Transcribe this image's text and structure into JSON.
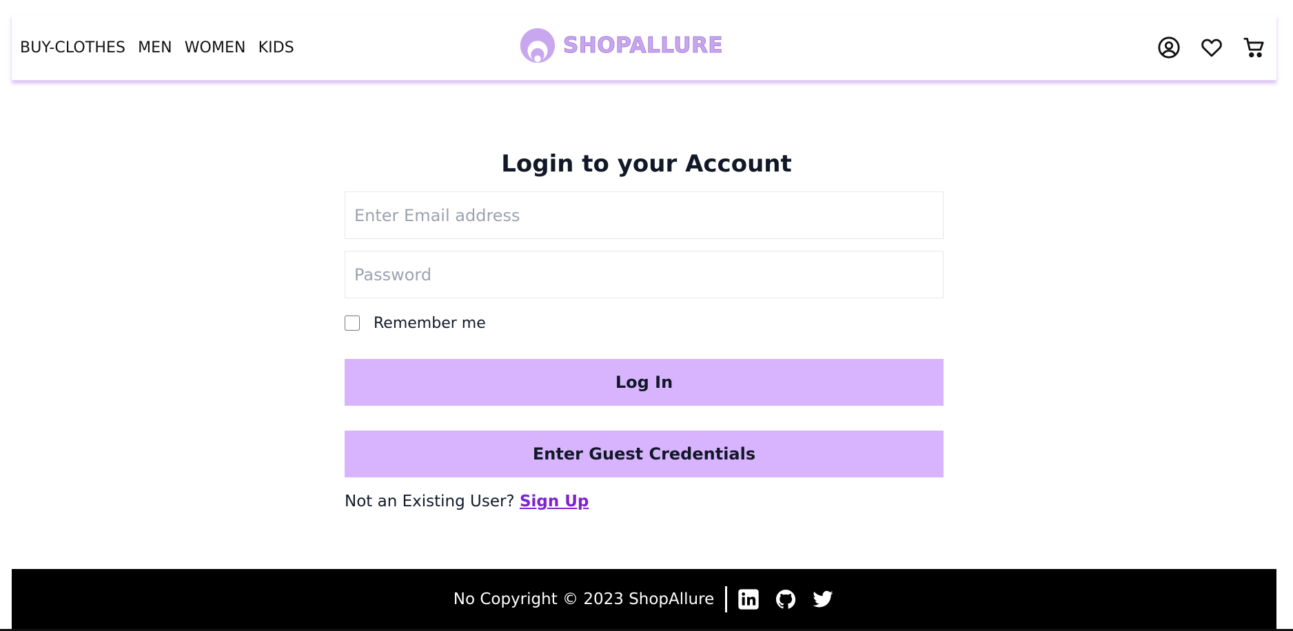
{
  "navbar": {
    "links": [
      "BUY-CLOTHES",
      "MEN",
      "WOMEN",
      "KIDS"
    ],
    "logo_text": "SHOPALLURE",
    "icons": [
      "user-circle-icon",
      "heart-icon",
      "cart-icon"
    ]
  },
  "login": {
    "title": "Login to your Account",
    "email_placeholder": "Enter Email address",
    "email_value": "",
    "password_placeholder": "Password",
    "password_value": "",
    "remember_label": "Remember me",
    "remember_checked": false,
    "login_button": "Log In",
    "guest_button": "Enter Guest Credentials",
    "signup_prompt": "Not an Existing User?",
    "signup_link": "Sign Up"
  },
  "footer": {
    "text": "No Copyright © 2023 ShopAllure",
    "icons": [
      "linkedin-icon",
      "github-icon",
      "twitter-icon"
    ]
  },
  "colors": {
    "accent": "#d8b4fe",
    "logo": "#c9a7ef",
    "link": "#7e22ce",
    "footer_bg": "#000000"
  }
}
